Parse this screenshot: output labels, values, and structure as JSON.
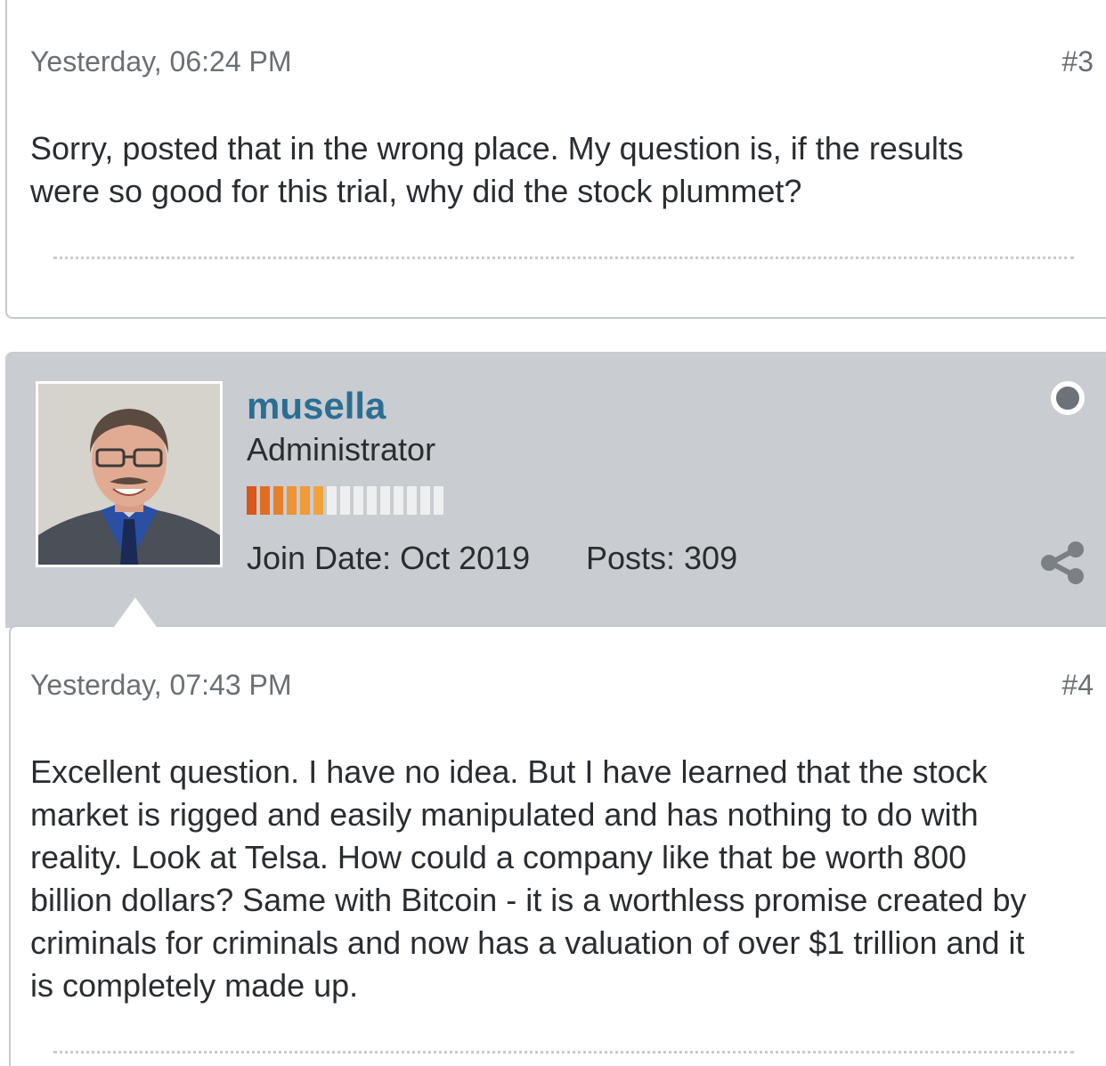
{
  "post3": {
    "date": "Yesterday, 06:24 PM",
    "number": "#3",
    "body_lines": [
      "Sorry, posted that in the wrong place. My question is, if the results",
      "were so good for this trial, why did the stock plummet?"
    ]
  },
  "author": {
    "username": "musella",
    "title": "Administrator",
    "reputation": {
      "filled": 6,
      "total": 15,
      "filled_colors": [
        "#d9561c",
        "#e06d24",
        "#e6802c",
        "#ec9334",
        "#ee9b38",
        "#f0a33c"
      ],
      "empty_color": "#eeeff0"
    },
    "join_date": "Join Date: Oct 2019",
    "posts": "Posts: 309",
    "status_icon": "offline-status-dot-icon",
    "share_icon": "share-icon"
  },
  "post4": {
    "date": "Yesterday, 07:43 PM",
    "number": "#4",
    "body_lines": [
      "Excellent question. I have no idea. But I have learned that the stock",
      "market is rigged and easily manipulated and has nothing to do with",
      "reality. Look at Telsa. How could a company like that be worth 800",
      "billion dollars? Same with Bitcoin - it is a worthless promise created by",
      "criminals for criminals and now has a valuation of over $1 trillion and it",
      "is completely made up."
    ]
  },
  "colors": {
    "username": "#2b6e93",
    "band": "#c9ccd0",
    "meta_text": "#6b6f73",
    "body_text": "#2a2d30"
  }
}
